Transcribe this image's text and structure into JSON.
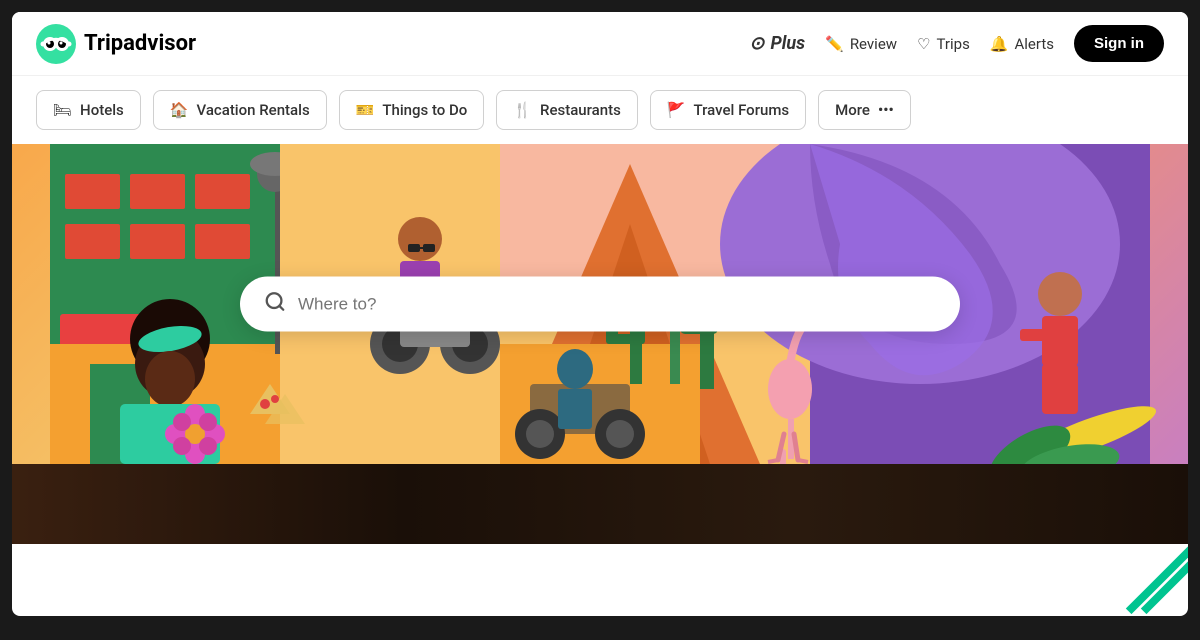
{
  "header": {
    "logo_text": "Tripadvisor",
    "nav": [
      {
        "id": "plus",
        "label": "Plus",
        "icon": "✦"
      },
      {
        "id": "review",
        "label": "Review",
        "icon": "✏️"
      },
      {
        "id": "trips",
        "label": "Trips",
        "icon": "♡"
      },
      {
        "id": "alerts",
        "label": "Alerts",
        "icon": "🔔"
      }
    ],
    "sign_in": "Sign in"
  },
  "tabs": [
    {
      "id": "hotels",
      "label": "Hotels",
      "icon": "🛏"
    },
    {
      "id": "vacation-rentals",
      "label": "Vacation Rentals",
      "icon": "🏠"
    },
    {
      "id": "things-to-do",
      "label": "Things to Do",
      "icon": "🎫"
    },
    {
      "id": "restaurants",
      "label": "Restaurants",
      "icon": "🍴"
    },
    {
      "id": "travel-forums",
      "label": "Travel Forums",
      "icon": "🚩"
    },
    {
      "id": "more",
      "label": "More",
      "icon": "⋯"
    }
  ],
  "search": {
    "placeholder": "Where to?"
  },
  "colors": {
    "tripadvisor_green": "#34E0A1",
    "black": "#000000",
    "hero_orange": "#f4a93a",
    "hero_purple": "#7b4db5"
  }
}
